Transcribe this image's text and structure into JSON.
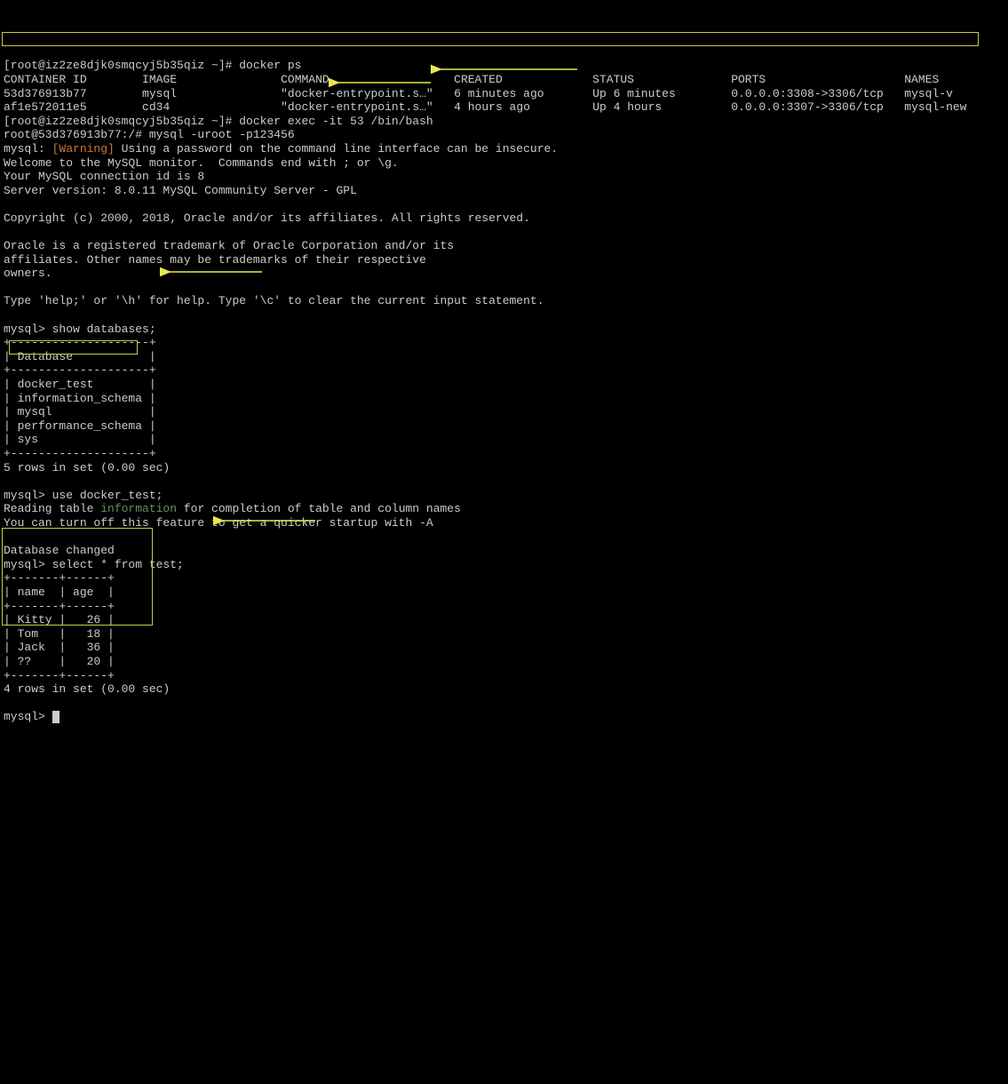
{
  "prompt1": "[root@iz2ze8djk0smqcyj5b35qiz ~]# ",
  "cmd_docker_ps": "docker ps",
  "headers": {
    "container_id": "CONTAINER ID",
    "image": "IMAGE",
    "command": "COMMAND",
    "created": "CREATED",
    "status": "STATUS",
    "ports": "PORTS",
    "names": "NAMES"
  },
  "rows": [
    {
      "id": "53d376913b77",
      "image": "mysql",
      "command": "\"docker-entrypoint.s…\"",
      "created": "6 minutes ago",
      "status": "Up 6 minutes",
      "ports": "0.0.0.0:3308->3306/tcp",
      "names": "mysql-v"
    },
    {
      "id": "af1e572011e5",
      "image": "cd34",
      "command": "\"docker-entrypoint.s…\"",
      "created": "4 hours ago",
      "status": "Up 4 hours",
      "ports": "0.0.0.0:3307->3306/tcp",
      "names": "mysql-new"
    }
  ],
  "cmd_docker_exec": "docker exec -it 53 /bin/bash",
  "prompt2": "root@53d376913b77:/# ",
  "cmd_mysql_login": "mysql -uroot -p123456",
  "mysql_prefix": "mysql: ",
  "warning_label": "[Warning]",
  "warning_text": " Using a password on the command line interface can be insecure.",
  "welcome1": "Welcome to the MySQL monitor.  Commands end with ; or \\g.",
  "welcome2": "Your MySQL connection id is 8",
  "welcome3": "Server version: 8.0.11 MySQL Community Server - GPL",
  "copyright": "Copyright (c) 2000, 2018, Oracle and/or its affiliates. All rights reserved.",
  "trademark1": "Oracle is a registered trademark of Oracle Corporation and/or its",
  "trademark2": "affiliates. Other names may be trademarks of their respective",
  "trademark3": "owners.",
  "help_text": "Type 'help;' or '\\h' for help. Type '\\c' to clear the current input statement.",
  "mysql_prompt": "mysql> ",
  "cmd_show_db": "show databases;",
  "db_border": "+--------------------+",
  "db_header": "| Database           |",
  "db_rows": [
    "| docker_test        |",
    "| information_schema |",
    "| mysql              |",
    "| performance_schema |",
    "| sys                |"
  ],
  "rows_5": "5 rows in set (0.00 sec)",
  "cmd_use_db": "use docker_test;",
  "reading1": "Reading table ",
  "reading_info": "information",
  "reading2": " for completion of table and column names",
  "reading3": "You can turn off this feature to get a quicker startup with -A",
  "db_changed": "Database changed",
  "cmd_select": "select * from test;",
  "test_border": "+-------+------+",
  "test_header": "| name  | age  |",
  "test_rows": [
    "| Kitty |   26 |",
    "| Tom   |   18 |",
    "| Jack  |   36 |",
    "| ??    |   20 |"
  ],
  "rows_4": "4 rows in set (0.00 sec)"
}
